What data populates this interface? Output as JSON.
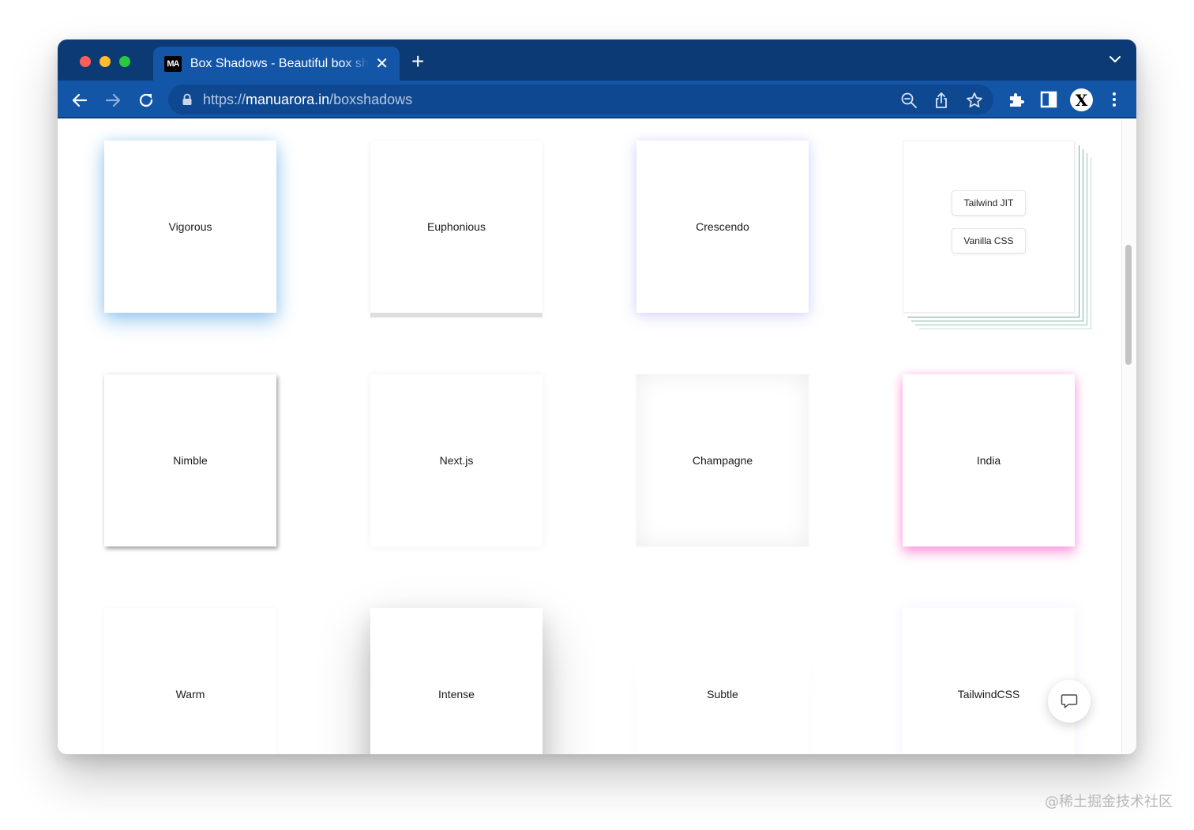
{
  "browser": {
    "tab": {
      "favicon_text": "MA",
      "title": "Box Shadows - Beautiful box shadows",
      "close": "✕"
    },
    "new_tab": "+",
    "url": {
      "scheme": "https://",
      "host": "manuarora.in",
      "path": "/boxshadows"
    },
    "profile_letter": "X"
  },
  "cards": [
    {
      "label": "Vigorous"
    },
    {
      "label": "Euphonious"
    },
    {
      "label": "Crescendo"
    },
    {
      "buttons": [
        "Tailwind JIT",
        "Vanilla CSS"
      ]
    },
    {
      "label": "Nimble"
    },
    {
      "label": "Next.js"
    },
    {
      "label": "Champagne"
    },
    {
      "label": "India"
    },
    {
      "label": "Warm"
    },
    {
      "label": "Intense"
    },
    {
      "label": "Subtle"
    },
    {
      "label": "TailwindCSS"
    }
  ],
  "watermark": "@稀土掘金技术社区",
  "colors": {
    "tabstrip": "#0c3a75",
    "toolbar": "#1356a8",
    "omnibox": "#0e4890"
  }
}
